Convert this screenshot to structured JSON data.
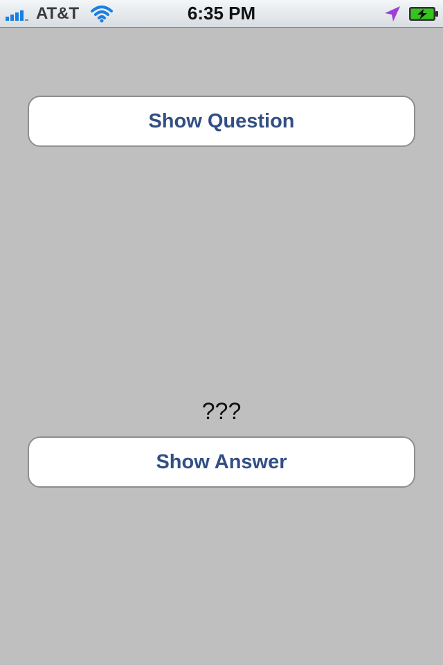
{
  "status_bar": {
    "carrier": "AT&T",
    "time": "6:35 PM",
    "signal_bars": 4,
    "signal_bars_max": 5,
    "wifi_icon": "wifi-icon",
    "location_icon": "location-arrow-icon",
    "battery_icon": "battery-charging-icon",
    "battery_level": 1.0,
    "colors": {
      "signal": "#1a7fe0",
      "location": "#9b3fd6",
      "battery": "#34c51d"
    }
  },
  "main": {
    "question_button_label": "Show Question",
    "answer_text": "???",
    "answer_button_label": "Show Answer"
  },
  "colors": {
    "background": "#bfbfbf",
    "button_text": "#324f85"
  }
}
